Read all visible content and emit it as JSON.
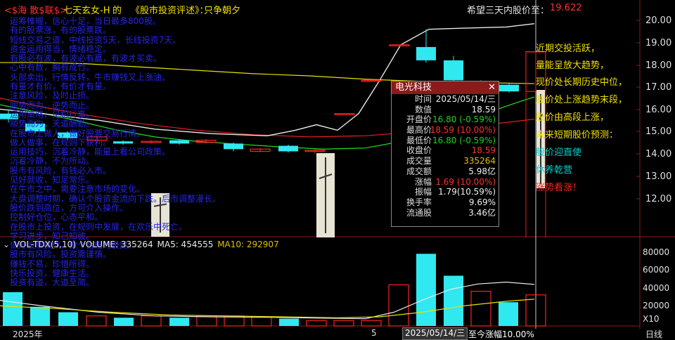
{
  "header": {
    "title_part1": "<$海 散$联$>",
    "title_part2": "七天玄女-H",
    "title_part3": "的",
    "title_part4": "《股市投资评述》：",
    "title_part5": "只争朝夕",
    "hope_label": "希望三天内股价至：",
    "hope_value": "19.622"
  },
  "poem_lines": [
    "运筹帷幄，信心十足，当日最多800股。",
    "有的股票涨，有的股票跌。",
    "短线交易之道，中线投资5天，长线投资7天。",
    "资金运用得当，情绪稳定。",
    "有股必有波，有波必有赢，有波才买卖。",
    "心中有数，胸有成竹。",
    "头部卖出，行情反转，牛市赚钱又上涨油。",
    "有量才有价，有价才有量。",
    "注意风险，及时止损。",
    "顺势而为，逆势而止。",
    "运用策略，见机行事。",
    "顺势而为，天道酬勤。",
    "在股市上做人，做好股票交易行情。",
    "做人做事，在规则下获利。",
    "运用技巧，沉着冷静，能量上看公司政策。",
    "沉着冷静，不为所动。",
    "股市有风险，有钱必入市。",
    "见好就收，知足常乐。",
    "在牛市之中，需要注意市场的变化。",
    "大盘调整时期，确认个股资金流向下跌。后市调整漫长。",
    "股价跌到高位，方可介入操作。",
    "控制好仓位，心态平和。",
    "在股市上投资，在规则中发展，在欢乐中死亡。",
    "学习进步，知己知彼。",
    "做好股票操作，做个合格的股民。",
    "股市有风险，投资需谨慎。",
    "赚钱不易，珍惜所得。",
    "快乐投资，健康生活。",
    "投资有道，大道至简。"
  ],
  "annotations": [
    {
      "text": "近期交投活跃，",
      "color": "yellow"
    },
    {
      "text": "量能呈放大趋势，",
      "color": "yellow"
    },
    {
      "text": "现价处长期历史中位，",
      "color": "yellow"
    },
    {
      "text": "股价处上涨趋势末段，",
      "color": "yellow"
    },
    {
      "text": "股价由高段上涨，",
      "color": "yellow"
    },
    {
      "text": "未来短期股价预测：",
      "color": "yellow"
    },
    {
      "text": "股价迎直使",
      "color": "cyan"
    },
    {
      "text": "休养乾营",
      "color": "cyan"
    },
    {
      "text": "涨势看涨！",
      "color": "red"
    }
  ],
  "price_axis": [
    "20.00",
    "19.00",
    "18.00",
    "17.00",
    "16.00",
    "15.00",
    "14.00",
    "13.00",
    "12.00"
  ],
  "volume_axis": [
    "80000",
    "60000",
    "40000",
    "20000",
    "X10"
  ],
  "info_panel": {
    "stock_name": "电光科技",
    "close_glyph": "✕",
    "rows": [
      {
        "label": "时间",
        "value": "2025/05/14/三",
        "color": "#eeeeee"
      },
      {
        "label": "数值",
        "value": "18.59",
        "color": "#eeeeee"
      },
      {
        "label": "开盘价",
        "value": "16.80 (-0.59%)",
        "color": "#20d020"
      },
      {
        "label": "最高价",
        "value": "18.59 (10.00%)",
        "color": "#ff3030"
      },
      {
        "label": "最低价",
        "value": "16.80 (-0.59%)",
        "color": "#20d020"
      },
      {
        "label": "收盘价",
        "value": "18.59",
        "color": "#ff3030"
      },
      {
        "label": "成交量",
        "value": "335264",
        "color": "#e0c000"
      },
      {
        "label": "成交额",
        "value": "5.98亿",
        "color": "#eeeeee"
      },
      {
        "label": "涨幅",
        "value": "1.69 (10.00%)",
        "color": "#ff3030"
      },
      {
        "label": "振幅",
        "value": "1.79(10.59%)",
        "color": "#eeeeee"
      },
      {
        "label": "换手率",
        "value": "9.69%",
        "color": "#eeeeee"
      },
      {
        "label": "流通股",
        "value": "3.46亿",
        "color": "#eeeeee"
      }
    ]
  },
  "volume_legend": {
    "name": "VOL-TDX(5,10)",
    "volume": "VOLUME: 335264",
    "ma5": "MA5: 454555",
    "ma10": "MA10: 292907"
  },
  "bottom_axis": {
    "year_label": "2025年",
    "month_label": "5",
    "cursor_label": "2025/05/14/三",
    "change_label": "至今涨幅10.00%",
    "period_label": "日线"
  },
  "colors": {
    "up": "#ff2020",
    "down": "#30e8f0",
    "ma_yellow": "#e8e000",
    "ma_green": "#20e020",
    "ma_red": "#e02020",
    "ma_white": "#e8e8e8",
    "panel_header": "#8b1a1a"
  }
}
